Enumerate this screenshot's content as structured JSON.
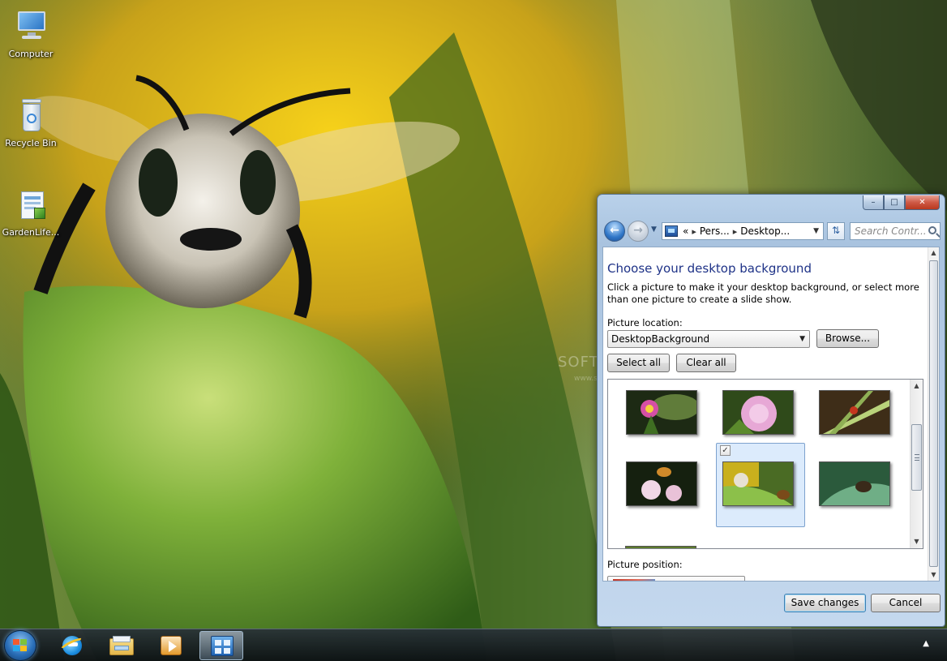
{
  "desktop": {
    "icons": [
      {
        "label": "Computer",
        "icon": "computer-icon"
      },
      {
        "label": "Recycle Bin",
        "icon": "recycle-bin-icon"
      },
      {
        "label": "GardenLife...",
        "icon": "theme-file-icon"
      }
    ],
    "watermark": "SOFTPEDIA",
    "watermark_url": "www.softpedia.com"
  },
  "window": {
    "controls": {
      "minimize": "–",
      "maximize": "□",
      "close": "✕"
    },
    "address": {
      "crumbs": [
        "Pers...",
        "Desktop..."
      ],
      "prefix": "«",
      "separator": "▸"
    },
    "search_placeholder": "Search Contr...",
    "heading": "Choose your desktop background",
    "description": "Click a picture to make it your desktop background, or select more than one picture to create a slide show.",
    "picture_location_label": "Picture location:",
    "picture_location_value": "DesktopBackground",
    "browse_label": "Browse...",
    "select_all_label": "Select all",
    "clear_all_label": "Clear all",
    "pictures": [
      {
        "name": "pink-flower",
        "selected": false
      },
      {
        "name": "pink-bloom",
        "selected": false
      },
      {
        "name": "ladybug-stem",
        "selected": false
      },
      {
        "name": "bee-on-blossom",
        "selected": false
      },
      {
        "name": "bee-on-leaf",
        "selected": true
      },
      {
        "name": "bug-on-leaf",
        "selected": false
      }
    ],
    "picture_position_label": "Picture position:",
    "save_label": "Save changes",
    "cancel_label": "Cancel"
  },
  "taskbar": {
    "items": [
      {
        "icon": "internet-explorer-icon",
        "active": false
      },
      {
        "icon": "file-explorer-icon",
        "active": false
      },
      {
        "icon": "media-player-icon",
        "active": false
      },
      {
        "icon": "control-panel-icon",
        "active": true
      }
    ],
    "tray_arrow": "▲"
  },
  "colors": {
    "heading": "#1e3287",
    "selection": "#dcebfc",
    "close_button": "#c8462f"
  }
}
